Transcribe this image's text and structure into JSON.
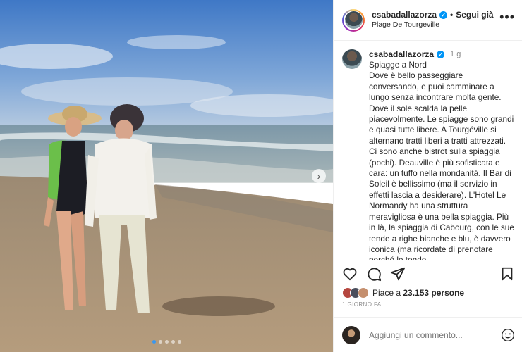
{
  "header": {
    "username": "csabadallazorza",
    "separator": "•",
    "follow_label": "Segui già",
    "location": "Plage De Tourgeville",
    "more_icon": "more-horizontal-icon"
  },
  "caption": {
    "username": "csabadallazorza",
    "time_ago": "1 g",
    "text": "Spiagge a Nord\nDove è bello passeggiare conversando, e puoi camminare a lungo senza incontrare molta gente. Dove il sole scalda la pelle piacevolmente. Le spiagge sono grandi e quasi tutte libere. A Tourgéville si alternano tratti liberi a tratti attrezzati. Ci sono anche bistrot sulla spiaggia (pochi). Deauville è più sofisticata e cara: un tuffo nella mondanità. Il Bar di Soleil è bellissimo (ma il servizio in effetti lascia a desiderare). L'Hotel Le Normandy ha una struttura meravigliosa è una bella spiaggia. Più in là, la spiaggia di Cabourg, con le sue tende a righe bianche e blu, è davvero iconica (ma ricordate di prenotare perché le tende"
  },
  "actions": {
    "like_icon": "heart-icon",
    "comment_icon": "comment-icon",
    "share_icon": "send-icon",
    "save_icon": "bookmark-icon"
  },
  "likes": {
    "prefix": "Piace a ",
    "count": "23.153 persone"
  },
  "time_label": "1 GIORNO FA",
  "comment_box": {
    "placeholder": "Aggiungi un commento...",
    "emoji_icon": "smiley-icon"
  },
  "carousel": {
    "next_icon": "chevron-right-icon",
    "slide_count": 5,
    "active_slide": 1
  },
  "colors": {
    "verified": "#0095f6",
    "active_dot": "#3897f0",
    "muted_text": "#8e8e8e"
  }
}
